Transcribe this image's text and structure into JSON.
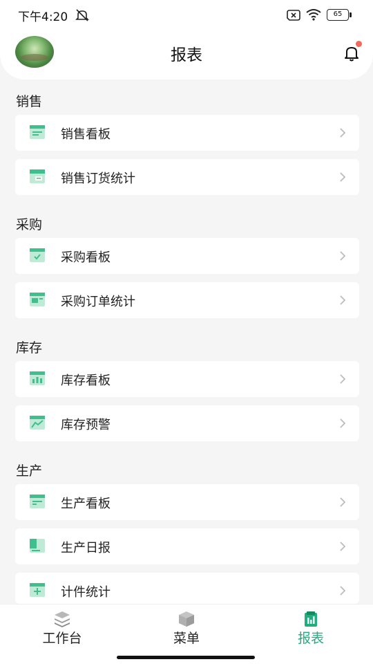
{
  "status_bar": {
    "time": "下午4:20",
    "battery": "65"
  },
  "header": {
    "title": "报表"
  },
  "sections": [
    {
      "title": "销售",
      "items": [
        {
          "label": "销售看板",
          "icon": "dashboard-icon"
        },
        {
          "label": "销售订货统计",
          "icon": "order-stats-icon"
        }
      ]
    },
    {
      "title": "采购",
      "items": [
        {
          "label": "采购看板",
          "icon": "dashboard-check-icon"
        },
        {
          "label": "采购订单统计",
          "icon": "order-stats-icon"
        }
      ]
    },
    {
      "title": "库存",
      "items": [
        {
          "label": "库存看板",
          "icon": "bar-chart-icon"
        },
        {
          "label": "库存预警",
          "icon": "trend-chart-icon"
        }
      ]
    },
    {
      "title": "生产",
      "items": [
        {
          "label": "生产看板",
          "icon": "dashboard-icon"
        },
        {
          "label": "生产日报",
          "icon": "daily-report-icon"
        },
        {
          "label": "计件统计",
          "icon": "piece-count-icon"
        }
      ]
    }
  ],
  "tabbar": {
    "tabs": [
      {
        "label": "工作台",
        "icon": "layers-icon",
        "active": false
      },
      {
        "label": "菜单",
        "icon": "cube-icon",
        "active": false
      },
      {
        "label": "报表",
        "icon": "report-icon",
        "active": true
      }
    ]
  },
  "colors": {
    "accent": "#1fae7c",
    "icon_green": "#3fbf8f",
    "badge": "#f06a5a"
  }
}
